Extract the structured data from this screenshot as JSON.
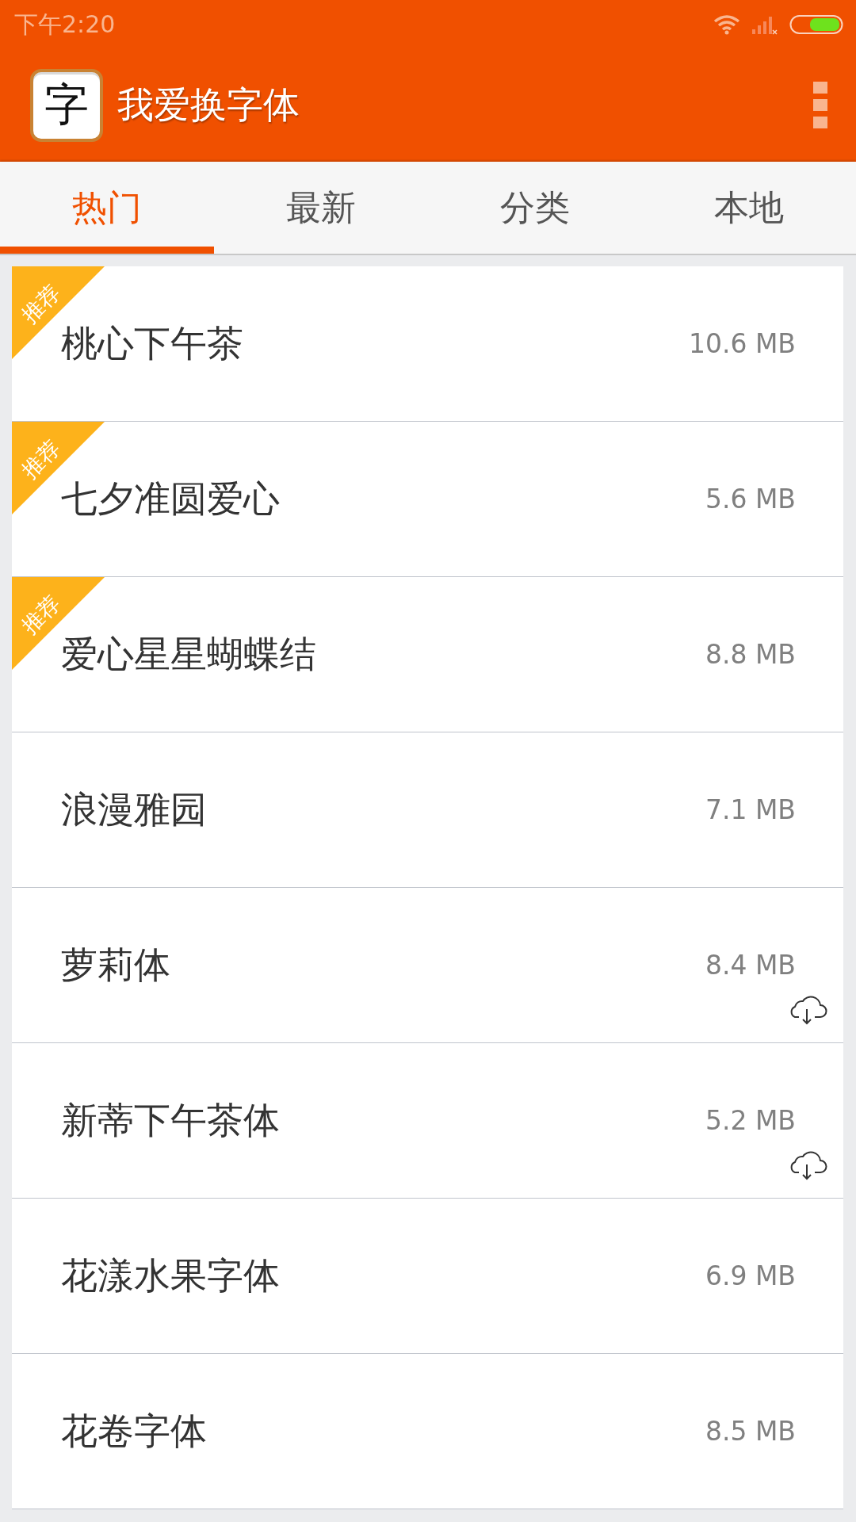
{
  "status_bar": {
    "time": "下午2:20"
  },
  "app_bar": {
    "icon_char": "字",
    "title": "我爱换字体"
  },
  "tabs": [
    {
      "label": "热门",
      "selected": true
    },
    {
      "label": "最新",
      "selected": false
    },
    {
      "label": "分类",
      "selected": false
    },
    {
      "label": "本地",
      "selected": false
    }
  ],
  "fonts": [
    {
      "name": "桃心下午茶",
      "size": "10.6 MB",
      "badge": "推荐",
      "recommended": true,
      "downloadable": false
    },
    {
      "name": "七夕准圆爱心",
      "size": "5.6 MB",
      "badge": "推荐",
      "recommended": true,
      "downloadable": false
    },
    {
      "name": "爱心星星蝴蝶结",
      "size": "8.8 MB",
      "badge": "推荐",
      "recommended": true,
      "downloadable": false
    },
    {
      "name": "浪漫雅园",
      "size": "7.1 MB",
      "recommended": false,
      "downloadable": false
    },
    {
      "name": "萝莉体",
      "size": "8.4 MB",
      "recommended": false,
      "downloadable": true
    },
    {
      "name": "新蒂下午茶体",
      "size": "5.2 MB",
      "recommended": false,
      "downloadable": true
    },
    {
      "name": "花漾水果字体",
      "size": "6.9 MB",
      "recommended": false,
      "downloadable": false
    },
    {
      "name": "花卷字体",
      "size": "8.5 MB",
      "recommended": false,
      "downloadable": false
    }
  ]
}
